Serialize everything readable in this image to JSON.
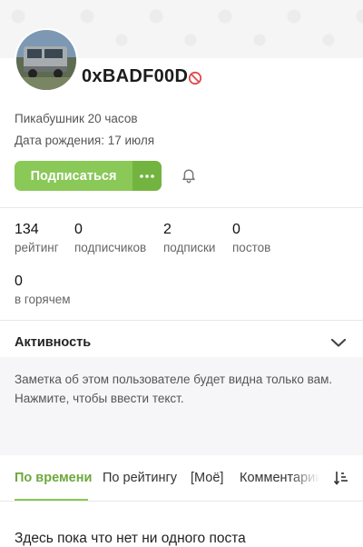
{
  "profile": {
    "username": "0xBADF00D",
    "tenure": "Пикабушник 20 часов",
    "birthday": "Дата рождения: 17 июля"
  },
  "actions": {
    "subscribe_label": "Подписаться",
    "more_label": "···"
  },
  "stats": [
    {
      "value": "134",
      "label": "рейтинг"
    },
    {
      "value": "0",
      "label": "подписчиков"
    },
    {
      "value": "2",
      "label": "подписки"
    },
    {
      "value": "0",
      "label": "постов"
    },
    {
      "value": "0",
      "label": "в горячем"
    }
  ],
  "activity": {
    "title": "Активность"
  },
  "note": {
    "text": "Заметка об этом пользователе будет видна только вам. Нажмите, чтобы ввести текст."
  },
  "tabs": [
    {
      "label": "По времени",
      "active": true
    },
    {
      "label": "По рейтингу",
      "active": false
    },
    {
      "label": "[Моё]",
      "active": false
    },
    {
      "label": "Комментарии",
      "active": false
    }
  ],
  "feed": {
    "empty_message": "Здесь пока что нет ни одного поста"
  },
  "colors": {
    "accent": "#8ac858",
    "accent_dark": "#73b441",
    "ban_red": "#e04b4b"
  },
  "icons": {
    "ban": "no-entry",
    "bell": "bell",
    "chevron": "chevron-down",
    "sort": "sort-descending"
  }
}
